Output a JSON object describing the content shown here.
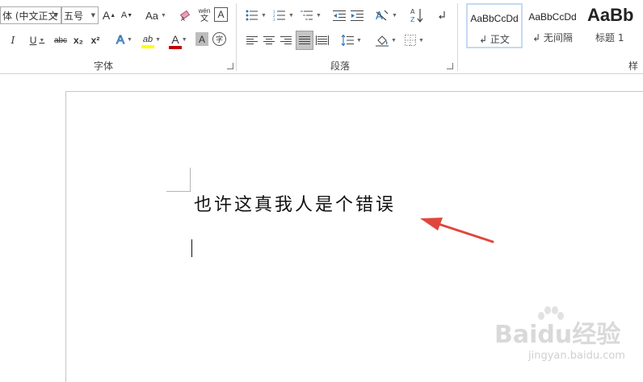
{
  "font_group": {
    "label": "字体",
    "font_name": "体 (中文正文",
    "font_size": "五号",
    "grow_label": "A",
    "shrink_label": "A",
    "case_label": "Aa",
    "phonetic_top": "wén",
    "phonetic_bottom": "文",
    "border_char_label": "A",
    "italic_label": "I",
    "underline_label": "U",
    "strike_label": "abc",
    "subscript_label": "x₂",
    "superscript_label": "x²",
    "effect_label": "A",
    "highlight_label": "ab",
    "font_color_label": "A",
    "shading_label": "A",
    "enclose_label": "字"
  },
  "paragraph_group": {
    "label": "段落"
  },
  "styles_group": {
    "label": "样式",
    "items": [
      {
        "sample": "AaBbCcDd",
        "name": "↲ 正文"
      },
      {
        "sample": "AaBbCcDd",
        "name": "↲ 无间隔"
      },
      {
        "sample": "AaBb",
        "name": "标题 1"
      }
    ]
  },
  "document": {
    "text": "也许这真我人是个错误"
  },
  "watermark": {
    "logo": "Baidu经验",
    "url": "jingyan.baidu.com"
  },
  "colors": {
    "highlight": "#ffff00",
    "font_color": "#c00000",
    "arrow": "#e0463c",
    "selected_style_border": "#c5d9f1",
    "justify_active": "#c5c5c5"
  },
  "icons": [
    "sort-icon",
    "show-marks-icon",
    "bullets-icon",
    "numbering-icon",
    "multilevel-icon",
    "decrease-indent-icon",
    "increase-indent-icon",
    "chinese-layout-icon",
    "align-left-icon",
    "center-icon",
    "align-right-icon",
    "justify-icon",
    "distributed-icon",
    "line-spacing-icon",
    "shading-icon",
    "borders-icon",
    "eraser-icon"
  ]
}
